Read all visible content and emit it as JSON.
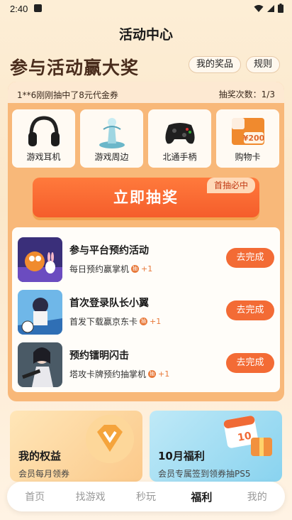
{
  "status": {
    "time": "2:40"
  },
  "title": "活动中心",
  "hero": "参与活动赢大奖",
  "pills": {
    "my_prizes": "我的奖品",
    "rules": "规则"
  },
  "ticker": {
    "winner": "1**6刚刚抽中了8元代金券",
    "draws": "抽奖次数：1/3"
  },
  "prizes": [
    {
      "label": "游戏耳机",
      "icon": "headphones-icon"
    },
    {
      "label": "游戏周边",
      "icon": "figurine-icon"
    },
    {
      "label": "北通手柄",
      "icon": "gamepad-icon"
    },
    {
      "label": "购物卡",
      "icon": "gift-card-icon",
      "value": "¥200"
    }
  ],
  "draw": {
    "label": "立即抽奖",
    "tag": "首抽必中"
  },
  "tasks": [
    {
      "name": "参与平台预约活动",
      "desc": "每日预约赢掌机",
      "plus": "+1",
      "button": "去完成"
    },
    {
      "name": "首次登录队长小翼",
      "desc": "首发下载赢京东卡",
      "plus": "+1",
      "button": "去完成"
    },
    {
      "name": "预约镭明闪击",
      "desc": "塔攻卡牌预约抽掌机",
      "plus": "+1",
      "button": "去完成"
    }
  ],
  "coin_glyph": "抽",
  "cards": [
    {
      "title": "我的权益",
      "sub": "会员每月领券"
    },
    {
      "title": "10月福利",
      "sub": "会员专属签到领券抽PS5"
    }
  ],
  "nav": [
    "首页",
    "找游戏",
    "秒玩",
    "福利",
    "我的"
  ],
  "active_nav": "福利",
  "colors": {
    "accent": "#f36b35",
    "panel": "#f8b879"
  }
}
